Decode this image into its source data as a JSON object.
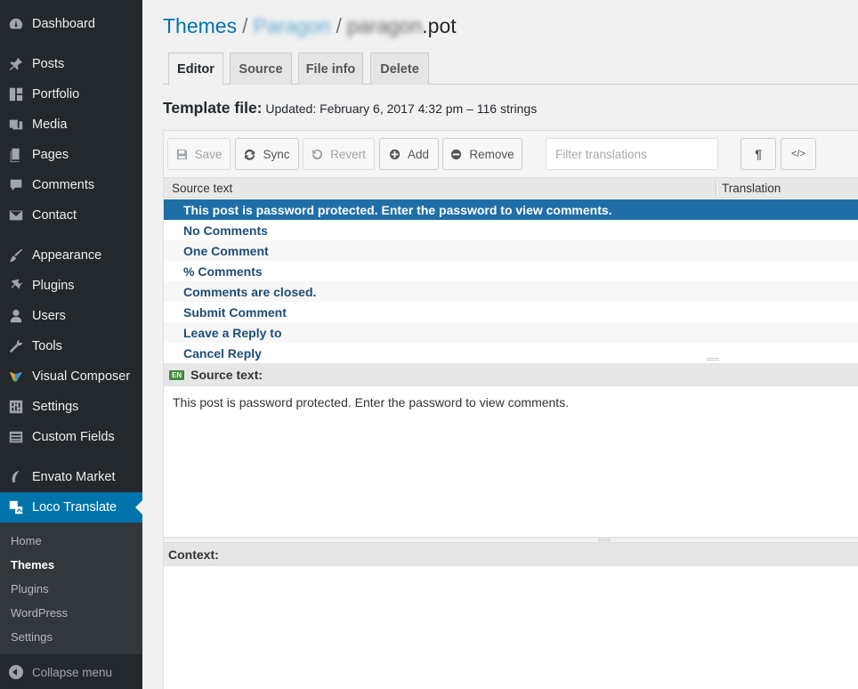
{
  "sidebar": {
    "items": [
      {
        "label": "Dashboard",
        "icon": "dashboard-icon"
      },
      {
        "label": "Posts",
        "icon": "pin-icon"
      },
      {
        "label": "Portfolio",
        "icon": "grid-icon"
      },
      {
        "label": "Media",
        "icon": "media-icon"
      },
      {
        "label": "Pages",
        "icon": "pages-icon"
      },
      {
        "label": "Comments",
        "icon": "comment-icon"
      },
      {
        "label": "Contact",
        "icon": "mail-icon"
      },
      {
        "label": "Appearance",
        "icon": "brush-icon"
      },
      {
        "label": "Plugins",
        "icon": "plug-icon"
      },
      {
        "label": "Users",
        "icon": "user-icon"
      },
      {
        "label": "Tools",
        "icon": "wrench-icon"
      },
      {
        "label": "Visual Composer",
        "icon": "vc-icon"
      },
      {
        "label": "Settings",
        "icon": "settings-icon"
      },
      {
        "label": "Custom Fields",
        "icon": "table-icon"
      },
      {
        "label": "Envato Market",
        "icon": "leaf-icon"
      },
      {
        "label": "Loco Translate",
        "icon": "translate-icon"
      }
    ],
    "submenu": [
      "Home",
      "Themes",
      "Plugins",
      "WordPress",
      "Settings"
    ],
    "collapse_label": "Collapse menu"
  },
  "header": {
    "crumb_root": "Themes",
    "crumb_sep": "/",
    "crumb_theme": "Paragon",
    "file_name_blurred": "paragon",
    "file_ext": ".pot"
  },
  "tabs": [
    "Editor",
    "Source",
    "File info",
    "Delete"
  ],
  "template": {
    "label": "Template file:",
    "info": "Updated: February 6, 2017 4:32 pm – 116 strings"
  },
  "toolbar": {
    "save": "Save",
    "sync": "Sync",
    "revert": "Revert",
    "add": "Add",
    "remove": "Remove",
    "filter_placeholder": "Filter translations",
    "pilcrow": "¶",
    "code": "</>"
  },
  "list": {
    "col_source": "Source text",
    "col_translation": "Translation",
    "rows": [
      "This post is password protected. Enter the password to view comments.",
      "No Comments",
      "One Comment",
      "% Comments",
      "Comments are closed.",
      "Submit Comment",
      "Leave a Reply to",
      "Cancel Reply"
    ]
  },
  "source_panel": {
    "lang_badge": "EN",
    "title": "Source text:",
    "text": "This post is password protected. Enter the password to view comments."
  },
  "context_panel": {
    "title": "Context:"
  },
  "colors": {
    "sidebar_bg": "#23282d",
    "accent": "#0073aa",
    "selected_row": "#1f6ea8"
  }
}
